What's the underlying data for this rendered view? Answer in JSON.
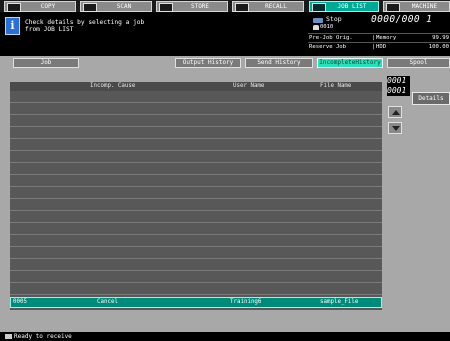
{
  "mode_tabs": [
    {
      "label": "COPY",
      "icon": "copy-icon"
    },
    {
      "label": "SCAN",
      "icon": "scan-icon"
    },
    {
      "label": "STORE",
      "icon": "store-icon"
    },
    {
      "label": "RECALL",
      "icon": "recall-icon"
    },
    {
      "label": "JOB LIST",
      "icon": "job-list-icon",
      "active": true
    },
    {
      "label": "MACHINE",
      "icon": "machine-icon"
    }
  ],
  "message": {
    "text": "Check details by selecting a job\nfrom JOB LIST"
  },
  "status": {
    "state": "Stop",
    "counter": "0000/000 1",
    "user_count": "0010",
    "rows": [
      {
        "left": "Pre-Job Orig.",
        "right_label": "Memory",
        "right_value": "99.99"
      },
      {
        "left": "Reserve Job",
        "right_label": "HDD",
        "right_value": "100.00"
      }
    ]
  },
  "sub_tabs": [
    {
      "label": "Job"
    },
    {
      "label": "Output History"
    },
    {
      "label": "Send History"
    },
    {
      "label": "IncompleteHistory",
      "active": true
    },
    {
      "label": "Spool"
    }
  ],
  "list": {
    "columns": [
      "Incomp. Cause",
      "User Name",
      "File Name"
    ],
    "rows": [
      {
        "id": "0005",
        "cause": "Cancel",
        "user": "Training6",
        "file": "sample_File"
      }
    ]
  },
  "page_indicator": {
    "current": "0001",
    "total": "0001"
  },
  "buttons": {
    "details": "Details"
  },
  "footer": {
    "status": "Ready to receive"
  },
  "colors": {
    "accent": "#00a896",
    "selected_tab": "#2be0b8",
    "background": "#a8a8a8"
  }
}
